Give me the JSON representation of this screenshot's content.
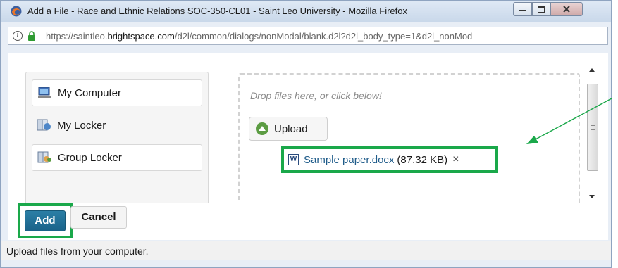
{
  "window": {
    "title": "Add a File - Race and Ethnic Relations SOC-350-CL01 - Saint Leo University - Mozilla Firefox",
    "icons": [
      "firefox-icon",
      "minimize-icon",
      "maximize-icon",
      "close-icon"
    ]
  },
  "urlbar": {
    "url_prefix": "https://saintleo.",
    "url_domain": "brightspace.com",
    "url_path": "/d2l/common/dialogs/nonModal/blank.d2l?d2l_body_type=1&d2l_nonMod"
  },
  "sources": [
    {
      "label": "My Computer",
      "icon": "computer-icon"
    },
    {
      "label": "My Locker",
      "icon": "locker-icon"
    },
    {
      "label": "Group Locker",
      "icon": "group-locker-icon"
    }
  ],
  "dropzone": {
    "hint": "Drop files here, or click below!",
    "upload_label": "Upload"
  },
  "file": {
    "name": "Sample paper.docx",
    "size": "(87.32 KB)",
    "remove": "×",
    "icon_letter": "W"
  },
  "actions": {
    "add_label": "Add",
    "cancel_label": "Cancel"
  },
  "status": {
    "text": "Upload files from your computer."
  },
  "colors": {
    "highlight_green": "#1aa84a",
    "primary_button": "#1f6f96"
  }
}
